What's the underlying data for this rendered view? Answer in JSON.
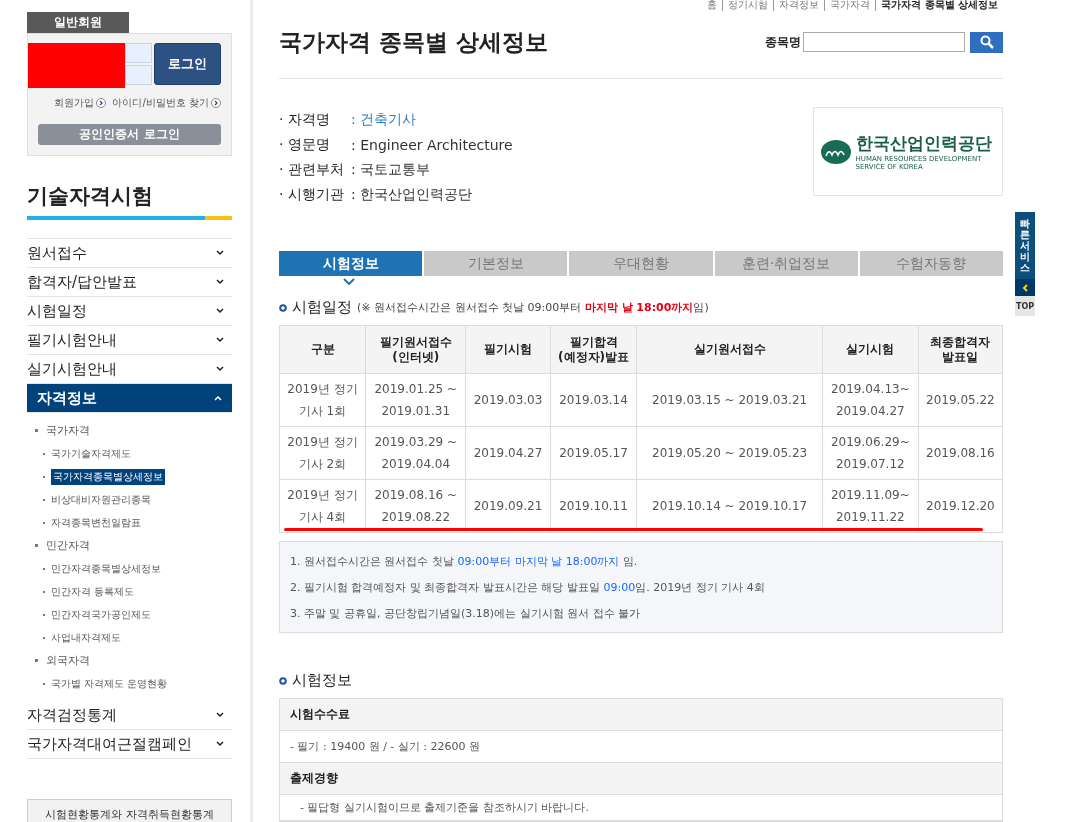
{
  "member": {
    "badge": "일반회원",
    "login_button": "로그인",
    "links": [
      "회원가입",
      "아이디/비밀번호 찾기"
    ],
    "cert_button": "공인인증서 로그인"
  },
  "sidebar": {
    "title": "기술자격시험",
    "menu": [
      {
        "label": "원서접수",
        "expanded": false
      },
      {
        "label": "합격자/답안발표",
        "expanded": false
      },
      {
        "label": "시험일정",
        "expanded": false
      },
      {
        "label": "필기시험안내",
        "expanded": false
      },
      {
        "label": "실기시험안내",
        "expanded": false
      },
      {
        "label": "자격정보",
        "expanded": true,
        "children": [
          {
            "label": "국가자격",
            "children": [
              {
                "label": "국가기술자격제도",
                "selected": false
              },
              {
                "label": "국가자격종목별상세정보",
                "selected": true
              },
              {
                "label": "비상대비자원관리종목",
                "selected": false
              },
              {
                "label": "자격종목변천일람표",
                "selected": false
              }
            ]
          },
          {
            "label": "민간자격",
            "children": [
              {
                "label": "민간자격종목별상세정보",
                "selected": false
              },
              {
                "label": "민간자격 등록제도",
                "selected": false
              },
              {
                "label": "민간자격국가공인제도",
                "selected": false
              },
              {
                "label": "사업내자격제도",
                "selected": false
              }
            ]
          },
          {
            "label": "외국자격",
            "children": [
              {
                "label": "국가별 자격제도 운영현황",
                "selected": false
              }
            ]
          }
        ]
      },
      {
        "label": "자격검정통계",
        "expanded": false
      },
      {
        "label": "국가자격대여근절캠페인",
        "expanded": false
      }
    ],
    "bottom_button": "시험현황통계와 자격취득현황통계"
  },
  "breadcrumb": [
    "홈",
    "정기시험",
    "자격정보",
    "국가자격",
    "국가자격 종목별 상세정보"
  ],
  "page_title": "국가자격 종목별 상세정보",
  "search": {
    "label": "종목명"
  },
  "info": [
    {
      "label": "· 자격명",
      "value": ": 건축기사",
      "kind": "link"
    },
    {
      "label": "· 영문명",
      "value": ": Engineer Architecture",
      "kind": "text"
    },
    {
      "label": "· 관련부처",
      "value": ": 국토교통부",
      "kind": "text"
    },
    {
      "label": "· 시행기관",
      "value": ": 한국산업인력공단",
      "kind": "text"
    }
  ],
  "logo": {
    "name": "한국산업인력공단",
    "subtitle": "HUMAN RESOURCES DEVELOPMENT SERVICE OF KOREA"
  },
  "tabs": [
    {
      "label": "시험정보",
      "selected": true
    },
    {
      "label": "기본정보",
      "selected": false
    },
    {
      "label": "우대현황",
      "selected": false
    },
    {
      "label": "훈련·취업정보",
      "selected": false
    },
    {
      "label": "수험자동향",
      "selected": false
    }
  ],
  "schedule": {
    "title": "시험일정",
    "note": "(※ 원서접수시간은 원서접수 첫날 09:00부터 **마지막 날 18:00까지**임)",
    "table": {
      "columns": [
        "구분",
        "필기원서접수\n(인터넷)",
        "필기시험",
        "필기합격\n(예정자)발표",
        "실기원서접수",
        "실기시험",
        "최종합격자\n발표일"
      ],
      "rows": [
        [
          "2019년 정기\n기사 1회",
          "2019.01.25 ~\n2019.01.31",
          "2019.03.03",
          "2019.03.14",
          "2019.03.15 ~ 2019.03.21",
          "2019.04.13~\n2019.04.27",
          "2019.05.22"
        ],
        [
          "2019년 정기\n기사 2회",
          "2019.03.29 ~\n2019.04.04",
          "2019.04.27",
          "2019.05.17",
          "2019.05.20 ~ 2019.05.23",
          "2019.06.29~\n2019.07.12",
          "2019.08.16"
        ],
        [
          "2019년 정기\n기사 4회",
          "2019.08.16 ~\n2019.08.22",
          "2019.09.21",
          "2019.10.11",
          "2019.10.14 ~ 2019.10.17",
          "2019.11.09~\n2019.11.22",
          "2019.12.20"
        ]
      ]
    },
    "notes": [
      "1. 원서접수시간은 원서접수 첫날 **09:00부터 마지막 날 18:00까지** 임.",
      "2. 필기시험 합격예정자 및 최종합격자 발표시간은 해당 발표일 **09:00**임. 2019년 정기 기사 4회",
      "3. 주말 및 공휴일, 공단창립기념일(3.18)에는 실기시험 원서 접수 불가"
    ]
  },
  "exam_info": {
    "title": "시험정보",
    "sections": [
      {
        "heading": "시험수수료",
        "body": "- 필기 : 19400 원 / - 실기 : 22600 원"
      },
      {
        "heading": "출제경향",
        "body": "- 필답형 실기시험이므로 출제기준을 참조하시기 바랍니다."
      }
    ]
  },
  "quick_service": {
    "label": "빠른서비스",
    "top": "TOP"
  }
}
